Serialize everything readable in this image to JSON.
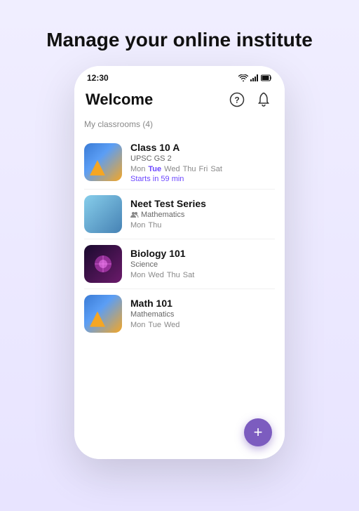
{
  "page": {
    "headline": "Manage your online institute"
  },
  "statusBar": {
    "time": "12:30"
  },
  "header": {
    "title": "Welcome",
    "helpIcon": "?",
    "bellIcon": "🔔"
  },
  "classrooms": {
    "sectionLabel": "My classrooms (4)",
    "items": [
      {
        "id": "class10a",
        "name": "Class 10 A",
        "subtitle": "UPSC GS 2",
        "days": [
          "Mon",
          "Tue",
          "Wed",
          "Thu",
          "Fri",
          "Sat"
        ],
        "activeDays": [
          "Tue"
        ],
        "startsIn": "Starts in 59 min",
        "thumb": "class10a"
      },
      {
        "id": "neet",
        "name": "Neet Test Series",
        "subtitle": "Mathematics",
        "subtitleIcon": "people",
        "days": [
          "Mon",
          "Thu"
        ],
        "activeDays": [],
        "startsIn": "",
        "thumb": "neet"
      },
      {
        "id": "bio101",
        "name": "Biology 101",
        "subtitle": "Science",
        "subtitleIcon": "",
        "days": [
          "Mon",
          "Wed",
          "Thu",
          "Sat"
        ],
        "activeDays": [],
        "startsIn": "",
        "thumb": "bio"
      },
      {
        "id": "math101",
        "name": "Math 101",
        "subtitle": "Mathematics",
        "subtitleIcon": "",
        "days": [
          "Mon",
          "Tue",
          "Wed"
        ],
        "activeDays": [],
        "startsIn": "",
        "thumb": "math101"
      }
    ]
  },
  "fab": {
    "label": "+"
  }
}
